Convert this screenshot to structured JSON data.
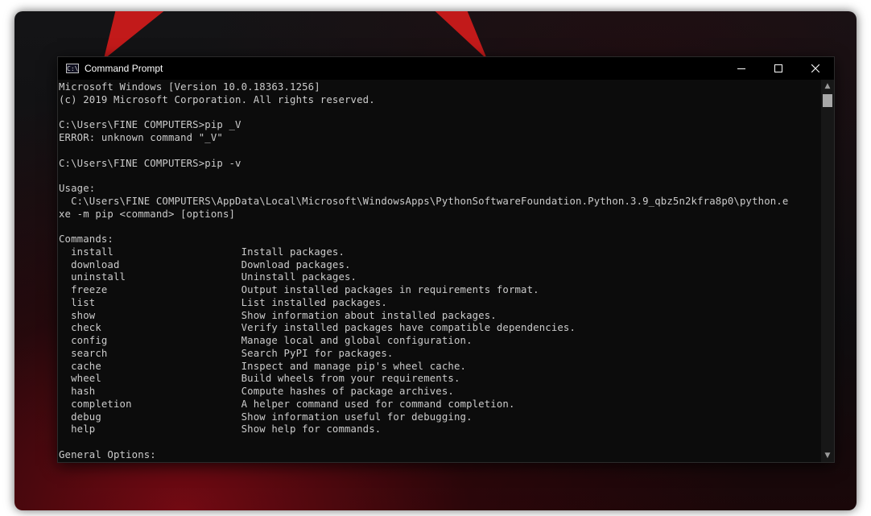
{
  "window": {
    "title": "Command Prompt",
    "icon": "cmd-icon",
    "icon_glyph": "C:\\",
    "controls": {
      "minimize": "minimize-icon",
      "maximize": "maximize-icon",
      "close": "close-icon"
    }
  },
  "console": {
    "lines": [
      "Microsoft Windows [Version 10.0.18363.1256]",
      "(c) 2019 Microsoft Corporation. All rights reserved.",
      "",
      "C:\\Users\\FINE COMPUTERS>pip _V",
      "ERROR: unknown command \"_V\"",
      "",
      "C:\\Users\\FINE COMPUTERS>pip -v",
      "",
      "Usage:",
      "  C:\\Users\\FINE COMPUTERS\\AppData\\Local\\Microsoft\\WindowsApps\\PythonSoftwareFoundation.Python.3.9_qbz5n2kfra8p0\\python.e",
      "xe -m pip <command> [options]",
      "",
      "Commands:",
      "  install                     Install packages.",
      "  download                    Download packages.",
      "  uninstall                   Uninstall packages.",
      "  freeze                      Output installed packages in requirements format.",
      "  list                        List installed packages.",
      "  show                        Show information about installed packages.",
      "  check                       Verify installed packages have compatible dependencies.",
      "  config                      Manage local and global configuration.",
      "  search                      Search PyPI for packages.",
      "  cache                       Inspect and manage pip's wheel cache.",
      "  wheel                       Build wheels from your requirements.",
      "  hash                        Compute hashes of package archives.",
      "  completion                  A helper command used for command completion.",
      "  debug                       Show information useful for debugging.",
      "  help                        Show help for commands.",
      "",
      "General Options:"
    ]
  },
  "scrollbar": {
    "up_icon": "scroll-up-icon",
    "down_icon": "scroll-down-icon",
    "up_glyph": "▲",
    "down_glyph": "▼"
  },
  "colors": {
    "console_bg": "#0c0c0c",
    "console_text": "#cccccc",
    "titlebar_bg": "#000000",
    "wallpaper_accent": "#c21a1a"
  }
}
